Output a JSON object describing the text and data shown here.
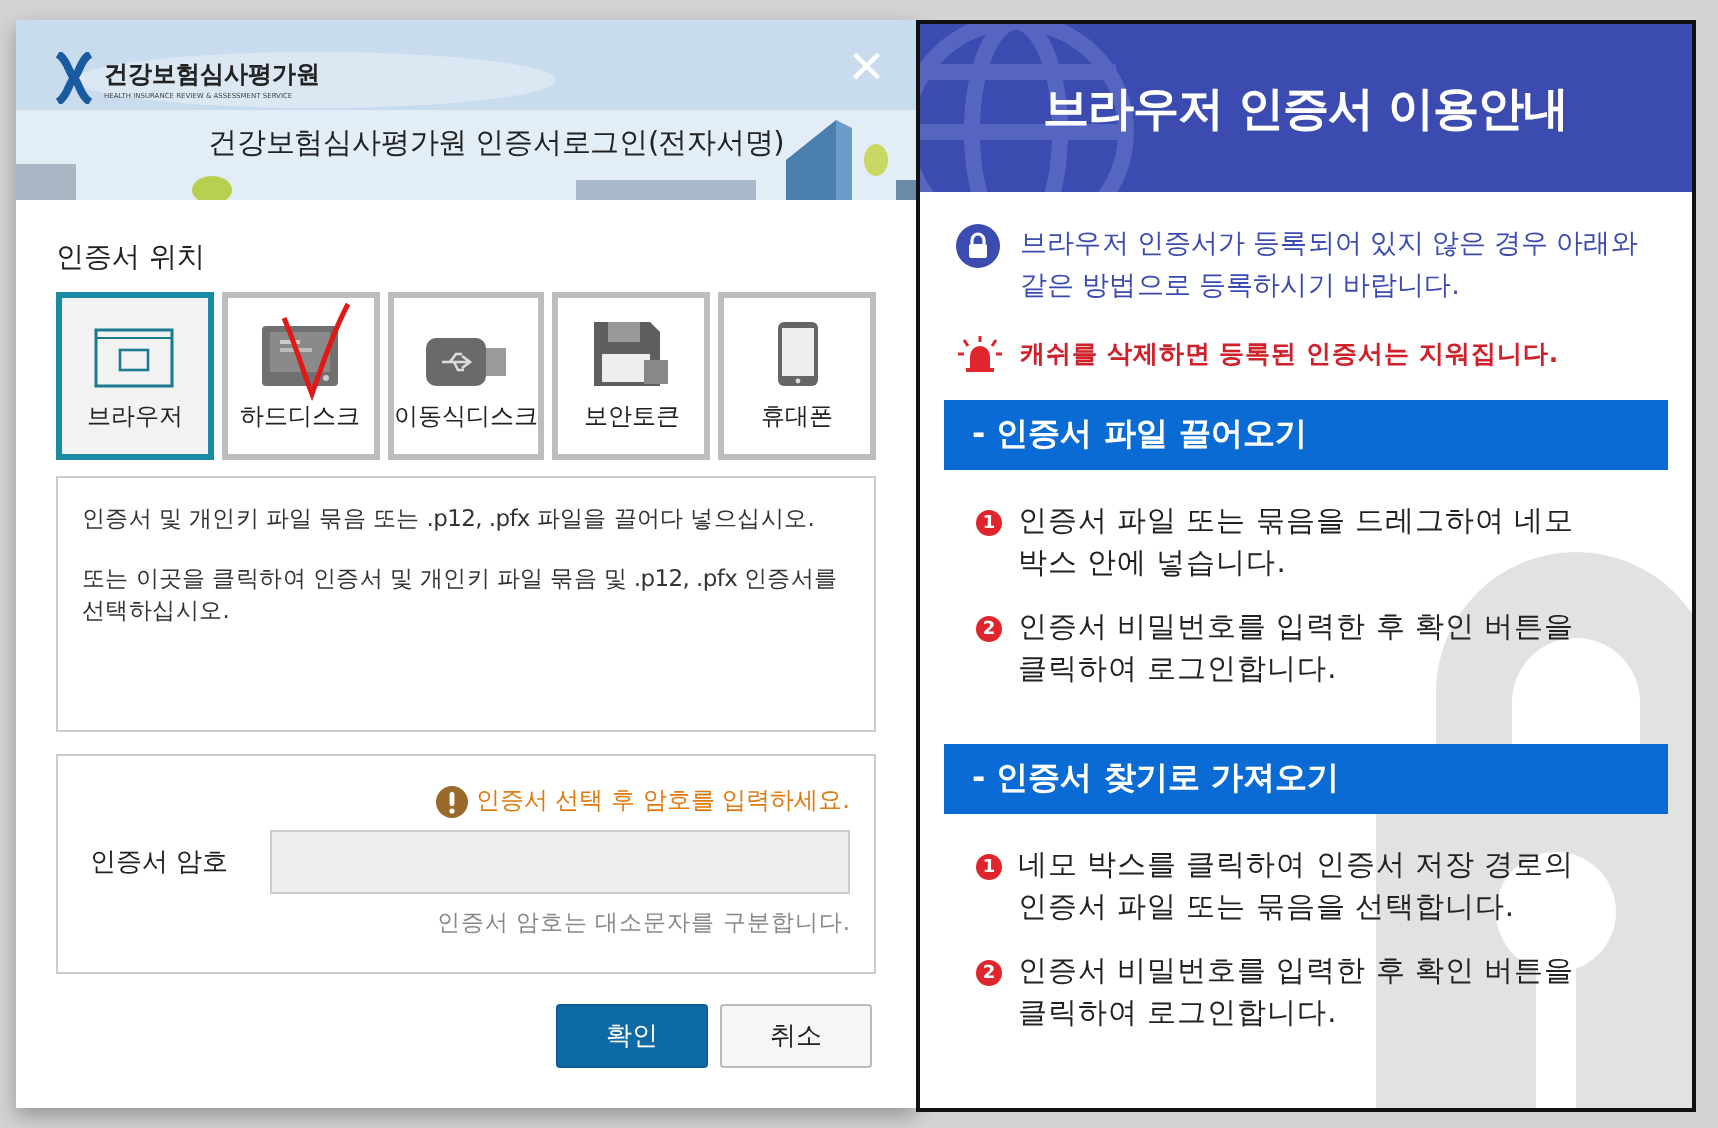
{
  "dialog": {
    "logo_name": "건강보험심사평가원",
    "logo_subtitle": "HEALTH INSURANCE REVIEW & ASSESSMENT SERVICE",
    "title": "건강보험심사평가원 인증서로그인(전자서명)",
    "close": "×",
    "location_label": "인증서 위치",
    "locations": [
      {
        "kind": "browser",
        "label": "브라우저",
        "selected": true
      },
      {
        "kind": "harddisk",
        "label": "하드디스크",
        "selected": false
      },
      {
        "kind": "usb",
        "label": "이동식디스크",
        "selected": false
      },
      {
        "kind": "token",
        "label": "보안토큰",
        "selected": false
      },
      {
        "kind": "phone",
        "label": "휴대폰",
        "selected": false
      }
    ],
    "drop_text": [
      "인증서 및 개인키 파일 묶음 또는 .p12, .pfx 파일을 끌어다 넣으십시오.",
      "또는 이곳을 클릭하여 인증서 및 개인키 파일 묶음 및 .p12, .pfx 인증서를 선택하십시오."
    ],
    "password_notice": "인증서 선택 후 암호를 입력하세요.",
    "password_label": "인증서 암호",
    "password_hint": "인증서 암호는 대소문자를 구분합니다.",
    "buttons": [
      {
        "kind": "primary",
        "label": "확인"
      },
      {
        "kind": "secondary",
        "label": "취소"
      }
    ]
  },
  "guide": {
    "title": "브라우저 인증서 이용안내",
    "info": "브라우저 인증서가 등록되어 있지 않은 경우 아래와 같은 방법으로 등록하시기 바랍니다.",
    "warning": "캐쉬를 삭제하면 등록된 인증서는 지워집니다.",
    "sections": [
      {
        "title": "- 인증서 파일 끌어오기",
        "steps": [
          {
            "number": "1",
            "text": "인증서 파일 또는 묶음을 드레그하여 네모박스 안에 넣습니다."
          },
          {
            "number": "2",
            "text": "인증서 비밀번호를 입력한 후 확인 버튼을 클릭하여 로그인합니다."
          }
        ]
      },
      {
        "title": "- 인증서 찾기로 가져오기",
        "steps": [
          {
            "number": "1",
            "text": "네모 박스를 클릭하여 인증서 저장 경로의 인증서 파일 또는 묶음을 선택합니다."
          },
          {
            "number": "2",
            "text": "인증서 비밀번호를 입력한 후 확인 버튼을 클릭하여 로그인합니다."
          }
        ]
      }
    ]
  }
}
